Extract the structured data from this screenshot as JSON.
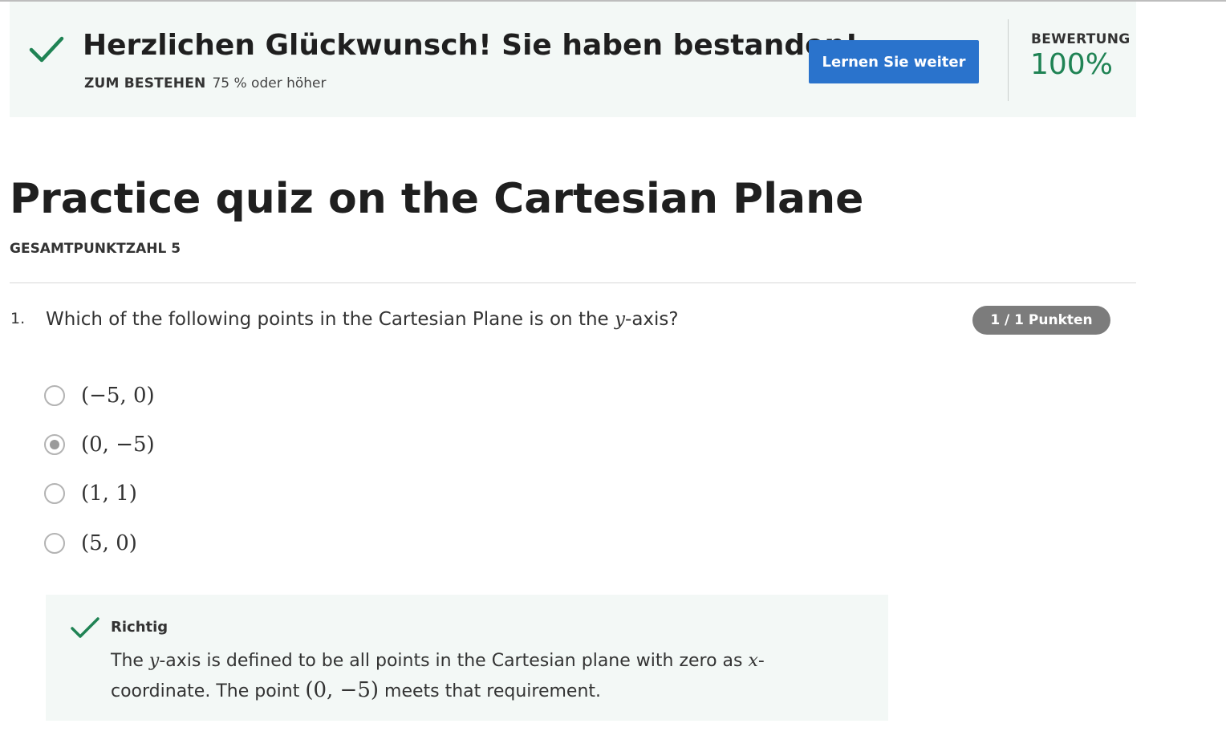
{
  "banner": {
    "title": "Herzlichen Glückwunsch! Sie haben bestanden!",
    "pass_label": "ZUM BESTEHEN",
    "pass_value": "75 % oder höher",
    "button_label": "Lernen Sie weiter",
    "grade_label": "BEWERTUNG",
    "grade_value": "100%",
    "check_icon": "check-icon",
    "accent_color": "#1f8354",
    "button_color": "#2a73cc"
  },
  "quiz": {
    "title": "Practice quiz on the Cartesian Plane",
    "total_points": "GESAMTPUNKTZAHL 5"
  },
  "question": {
    "number": "1.",
    "text_before": "Which of the following points in the Cartesian Plane is on the ",
    "variable": "y",
    "text_after": "-axis?",
    "score_badge": "1 / 1 Punkten",
    "options": [
      {
        "text": "(−5, 0)",
        "selected": false
      },
      {
        "text": "(0, −5)",
        "selected": true
      },
      {
        "text": "(1, 1)",
        "selected": false
      },
      {
        "text": "(5, 0)",
        "selected": false
      }
    ]
  },
  "feedback": {
    "title": "Richtig",
    "t1": "The ",
    "v1": "y",
    "t2": "-axis is defined to be all points in the Cartesian plane with zero as ",
    "v2": "x",
    "t3": "-coordinate. The point ",
    "m1": "(0, −5)",
    "t4": " meets that requirement."
  }
}
